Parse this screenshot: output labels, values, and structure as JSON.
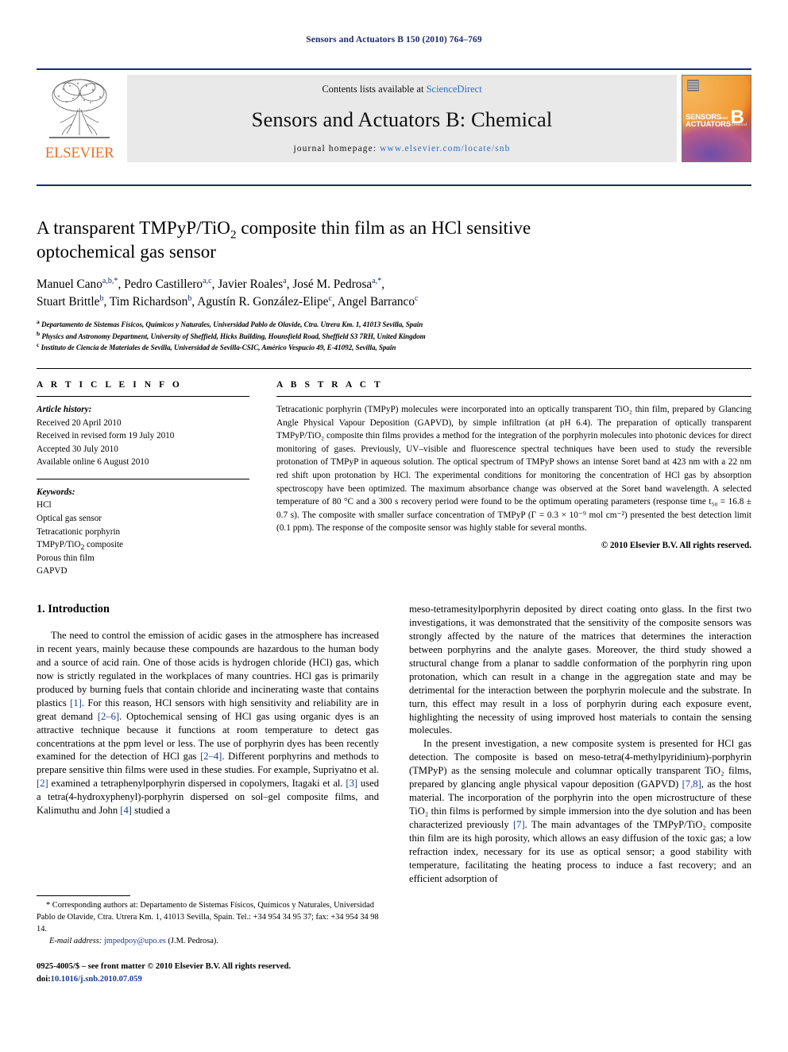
{
  "running_head": "Sensors and Actuators B 150 (2010) 764–769",
  "masthead": {
    "publisher": "ELSEVIER",
    "contents_prefix": "Contents lists available at ",
    "contents_link": "ScienceDirect",
    "journal_title": "Sensors and Actuators B: Chemical",
    "homepage_label": "journal homepage:",
    "homepage_url": "www.elsevier.com/locate/snb",
    "cover": {
      "line1": "SENSORS",
      "and": "and",
      "line2": "ACTUATORS",
      "letter": "B",
      "sub": "Chemical"
    }
  },
  "article": {
    "title_line1_a": "A transparent TMPyP/TiO",
    "title_line1_sub": "2",
    "title_line1_b": " composite thin film as an HCl sensitive",
    "title_line2": "optochemical gas sensor",
    "authors": [
      {
        "name": "Manuel Cano",
        "sup": "a,b,*"
      },
      {
        "name": "Pedro Castillero",
        "sup": "a,c"
      },
      {
        "name": "Javier Roales",
        "sup": "a"
      },
      {
        "name": "José M. Pedrosa",
        "sup": "a,*"
      },
      {
        "name": "Stuart Brittle",
        "sup": "b"
      },
      {
        "name": "Tim Richardson",
        "sup": "b"
      },
      {
        "name": "Agustín R. González-Elipe",
        "sup": "c"
      },
      {
        "name": "Angel Barranco",
        "sup": "c"
      }
    ],
    "affiliations": [
      {
        "sup": "a",
        "text": "Departamento de Sistemas Físicos, Químicos y Naturales, Universidad Pablo de Olavide, Ctra. Utrera Km. 1, 41013 Sevilla, Spain"
      },
      {
        "sup": "b",
        "text": "Physics and Astronomy Department, University of Sheffield, Hicks Building, Hounsfield Road, Sheffield S3 7RH, United Kingdom"
      },
      {
        "sup": "c",
        "text": "Instituto de Ciencia de Materiales de Sevilla, Universidad de Sevilla-CSIC, Américo Vespucio 49, E-41092, Sevilla, Spain"
      }
    ]
  },
  "article_info": {
    "heading": "A R T I C L E    I N F O",
    "history_label": "Article history:",
    "history": [
      "Received 20 April 2010",
      "Received in revised form 19 July 2010",
      "Accepted 30 July 2010",
      "Available online 6 August 2010"
    ],
    "keywords_label": "Keywords:",
    "keywords": [
      "HCl",
      "Optical gas sensor",
      "Tetracationic porphyrin",
      "TMPyP/TiO2 composite",
      "Porous thin film",
      "GAPVD"
    ]
  },
  "abstract": {
    "heading": "A B S T R A C T",
    "text": "Tetracationic porphyrin (TMPyP) molecules were incorporated into an optically transparent TiO₂ thin film, prepared by Glancing Angle Physical Vapour Deposition (GAPVD), by simple infiltration (at pH 6.4). The preparation of optically transparent TMPyP/TiO₂ composite thin films provides a method for the integration of the porphyrin molecules into photonic devices for direct monitoring of gases. Previously, UV–visible and fluorescence spectral techniques have been used to study the reversible protonation of TMPyP in aqueous solution. The optical spectrum of TMPyP shows an intense Soret band at 423 nm with a 22 nm red shift upon protonation by HCl. The experimental conditions for monitoring the concentration of HCl gas by absorption spectroscopy have been optimized. The maximum absorbance change was observed at the Soret band wavelength. A selected temperature of 80 °C and a 300 s recovery period were found to be the optimum operating parameters (response time t₅₀ = 16.8 ± 0.7 s). The composite with smaller surface concentration of TMPyP (Γ = 0.3 × 10⁻⁹ mol cm⁻²) presented the best detection limit (0.1 ppm). The response of the composite sensor was highly stable for several months.",
    "copyright": "© 2010 Elsevier B.V. All rights reserved."
  },
  "sections": {
    "introduction_heading": "1. Introduction",
    "intro_p1": "The need to control the emission of acidic gases in the atmosphere has increased in recent years, mainly because these compounds are hazardous to the human body and a source of acid rain. One of those acids is hydrogen chloride (HCl) gas, which now is strictly regulated in the workplaces of many countries. HCl gas is primarily produced by burning fuels that contain chloride and incinerating waste that contains plastics [1]. For this reason, HCl sensors with high sensitivity and reliability are in great demand [2–6]. Optochemical sensing of HCl gas using organic dyes is an attractive technique because it functions at room temperature to detect gas concentrations at the ppm level or less. The use of porphyrin dyes has been recently examined for the detection of HCl gas [2–4]. Different porphyrins and methods to prepare sensitive thin films were used in these studies. For example, Supriyatno et al. [2] examined a tetraphenylporphyrin dispersed in copolymers, Itagaki et al. [3] used a tetra(4-hydroxyphenyl)-porphyrin dispersed on sol–gel composite films, and Kalimuthu and John [4] studied a meso-tetramesitylporphyrin deposited by direct coating onto glass. In the first two investigations, it was demonstrated that the sensitivity of the composite sensors was strongly affected by the nature of the matrices that determines the interaction between porphyrins and the analyte gases. Moreover, the third study showed a structural change from a planar to saddle conformation of the porphyrin ring upon protonation, which can result in a change in the aggregation state and may be detrimental for the interaction between the porphyrin molecule and the substrate. In turn, this effect may result in a loss of porphyrin during each exposure event, highlighting the necessity of using improved host materials to contain the sensing molecules.",
    "intro_p2": "In the present investigation, a new composite system is presented for HCl gas detection. The composite is based on meso-tetra(4-methylpyridinium)-porphyrin (TMPyP) as the sensing molecule and columnar optically transparent TiO₂ films, prepared by glancing angle physical vapour deposition (GAPVD) [7,8], as the host material. The incorporation of the porphyrin into the open microstructure of these TiO₂ thin films is performed by simple immersion into the dye solution and has been characterized previously [7]. The main advantages of the TMPyP/TiO₂ composite thin film are its high porosity, which allows an easy diffusion of the toxic gas; a low refraction index, necessary for its use as optical sensor; a good stability with temperature, facilitating the heating process to induce a fast recovery; and an efficient adsorption of"
  },
  "footnote": {
    "star_text": "* Corresponding authors at: Departamento de Sistemas Físicos, Químicos y Naturales, Universidad Pablo de Olavide, Ctra. Utrera Km. 1, 41013 Sevilla, Spain. Tel.: +34 954 34 95 37; fax: +34 954 34 98 14.",
    "email_label": "E-mail address:",
    "email": "jmpedpoy@upo.es",
    "email_owner": "(J.M. Pedrosa)."
  },
  "imprint": {
    "line1": "0925-4005/$ – see front matter © 2010 Elsevier B.V. All rights reserved.",
    "doi_label": "doi:",
    "doi": "10.1016/j.snb.2010.07.059"
  },
  "colors": {
    "header_blue": "#1b2a6b",
    "link_blue": "#2a6ebb",
    "ref_blue": "#1b3d8f",
    "elsevier_orange": "#e87424",
    "mast_gray": "#e9e9e9"
  }
}
